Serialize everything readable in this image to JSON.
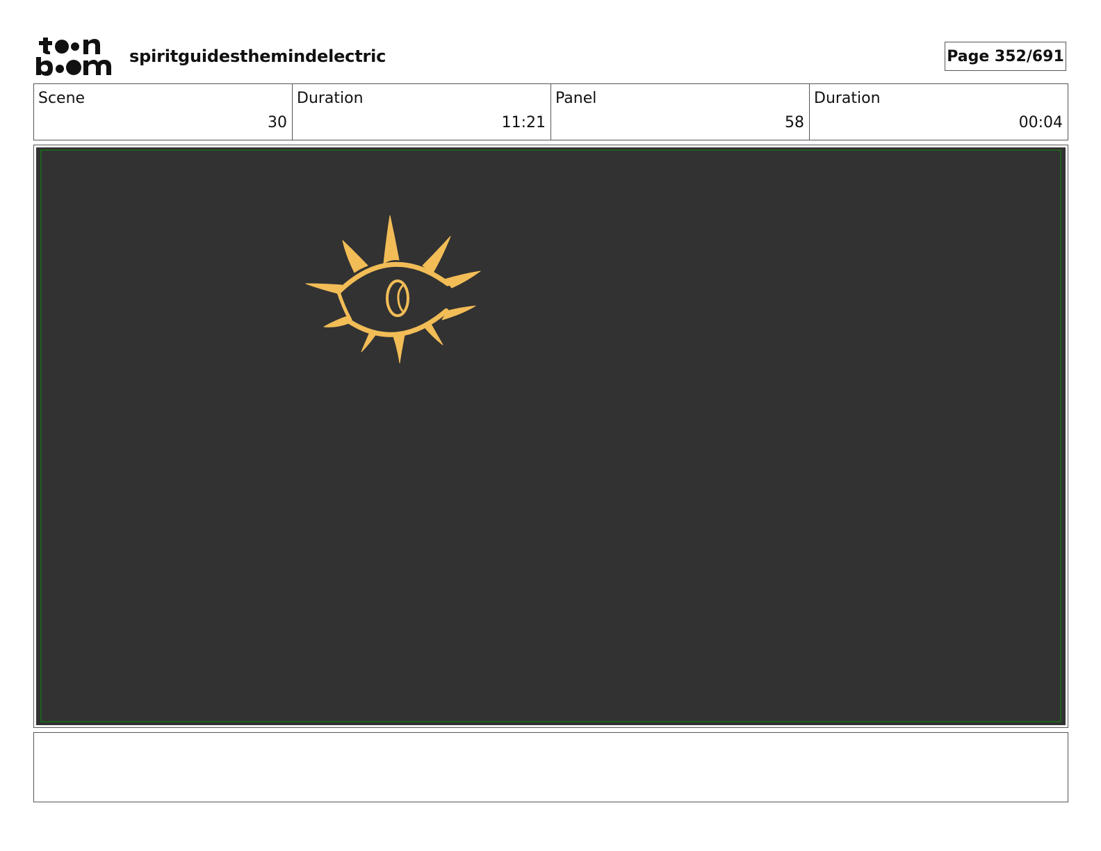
{
  "logo": {
    "lines": [
      "toon",
      "boom"
    ],
    "icon": "toon-boom-logo"
  },
  "header": {
    "project_title": "spiritguidesthemindelectric",
    "page_label": "Page 352/691"
  },
  "info": {
    "scene_label": "Scene",
    "scene_value": "30",
    "scene_duration_label": "Duration",
    "scene_duration_value": "11:21",
    "panel_label": "Panel",
    "panel_value": "58",
    "panel_duration_label": "Duration",
    "panel_duration_value": "00:04"
  },
  "panel": {
    "background_color": "#323232",
    "safe_frame_color": "#1f5f1f",
    "drawing_color": "#f2bd57",
    "drawing_icon": "eye-sun-icon"
  },
  "notes": {
    "text": ""
  }
}
